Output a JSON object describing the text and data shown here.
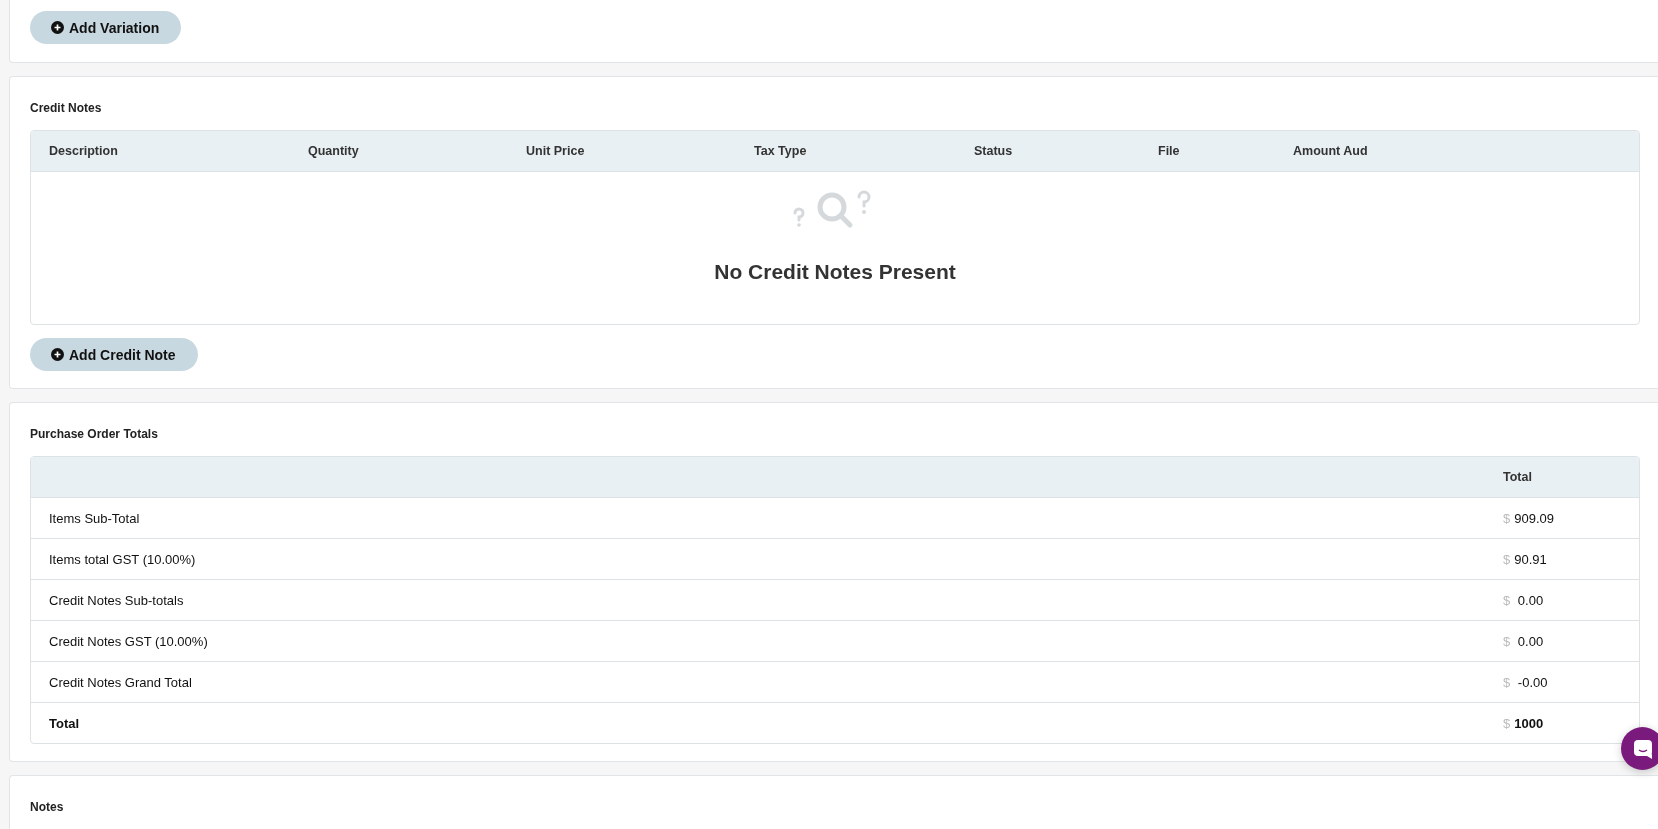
{
  "variations": {
    "add_button": "Add Variation"
  },
  "credit_notes": {
    "title": "Credit Notes",
    "columns": [
      "Description",
      "Quantity",
      "Unit Price",
      "Tax Type",
      "Status",
      "File",
      "Amount Aud"
    ],
    "empty_message": "No Credit Notes Present",
    "add_button": "Add Credit Note"
  },
  "totals": {
    "title": "Purchase Order Totals",
    "column": "Total",
    "rows": [
      {
        "label": "Items Sub-Total",
        "currency": "$",
        "amount": "909.09",
        "bold": false
      },
      {
        "label": "Items total GST (10.00%)",
        "currency": "$",
        "amount": "90.91",
        "bold": false
      },
      {
        "label": "Credit Notes Sub-totals",
        "currency": "$",
        "amount": " 0.00",
        "bold": false
      },
      {
        "label": "Credit Notes GST (10.00%)",
        "currency": "$",
        "amount": " 0.00",
        "bold": false
      },
      {
        "label": "Credit Notes Grand Total",
        "currency": "$",
        "amount": " -0.00",
        "bold": false
      },
      {
        "label": "Total",
        "currency": "$",
        "amount": "1000",
        "bold": true
      }
    ]
  },
  "notes": {
    "title": "Notes"
  }
}
